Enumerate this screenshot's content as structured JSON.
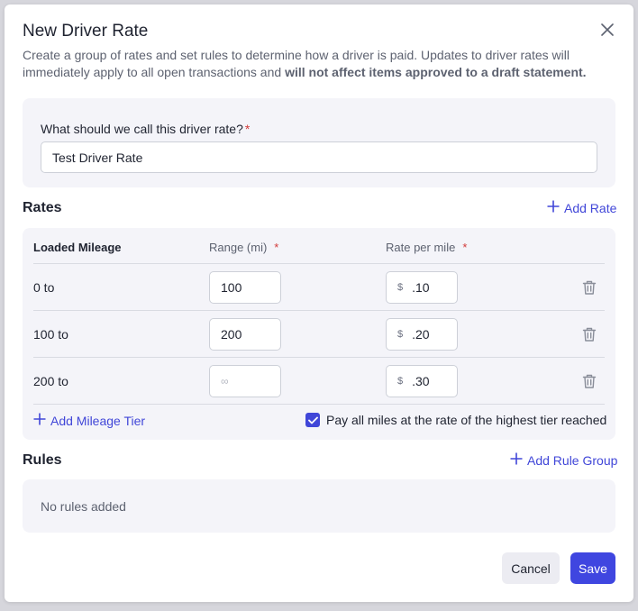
{
  "modal": {
    "title": "New Driver Rate",
    "subtitle_plain": "Create a group of rates and set rules to determine how a driver is paid. Updates to driver rates will immediately apply to all open transactions and ",
    "subtitle_bold": "will not affect items approved to a draft statement.",
    "close_icon": "close-icon"
  },
  "name_field": {
    "label": "What should we call this driver rate?",
    "required_mark": "*",
    "value": "Test Driver Rate"
  },
  "rates": {
    "section_title": "Rates",
    "add_rate_label": "Add Rate",
    "columns": {
      "tier": "Loaded Mileage",
      "range": "Range (mi)",
      "range_required": "*",
      "rate": "Rate per mile",
      "rate_required": "*"
    },
    "currency_symbol": "$",
    "tiers": [
      {
        "label": "0 to",
        "range": "100",
        "rate": ".10"
      },
      {
        "label": "100 to",
        "range": "200",
        "rate": ".20"
      },
      {
        "label": "200 to",
        "range_placeholder": "∞",
        "rate": ".30"
      }
    ],
    "add_tier_label": "Add Mileage Tier",
    "highest_tier_checkbox": {
      "label": "Pay all miles at the rate of the highest tier reached",
      "checked": true
    }
  },
  "rules": {
    "section_title": "Rules",
    "add_rule_group_label": "Add Rule Group",
    "empty_text": "No rules added"
  },
  "footer": {
    "cancel_label": "Cancel",
    "save_label": "Save"
  },
  "colors": {
    "accent": "#4046d8",
    "primary_button": "#3f46e0",
    "required": "#d23a3a",
    "card_bg": "#f4f4f9"
  }
}
